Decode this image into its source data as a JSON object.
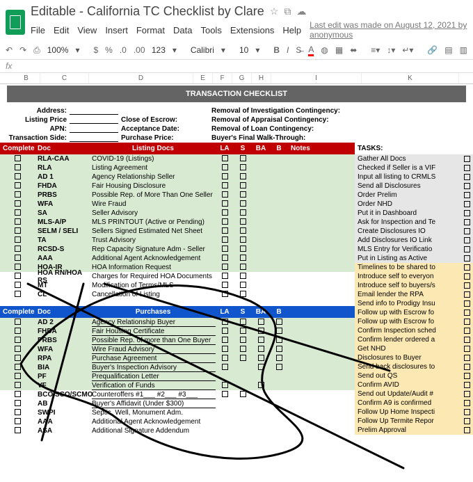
{
  "doc": {
    "title": "Editable - California TC Checklist by Clare"
  },
  "menu": [
    "File",
    "Edit",
    "View",
    "Insert",
    "Format",
    "Data",
    "Tools",
    "Extensions",
    "Help"
  ],
  "last_edit": "Last edit was made on August 12, 2021 by anonymous",
  "toolbar": {
    "zoom": "100%",
    "font": "Calibri",
    "size": "10",
    "fmt": "123"
  },
  "banner": "TRANSACTION CHECKLIST",
  "form": {
    "rows": [
      {
        "a": "Address:",
        "b": "",
        "c": "Removal of Investigation Contingency:"
      },
      {
        "a": "Listing Price",
        "b": "Close of Escrow:",
        "c": "Removal of Appraisal Contingency:"
      },
      {
        "a": "APN:",
        "b": "Acceptance Date:",
        "c": "Removal of Loan Contingency:"
      },
      {
        "a": "Transaction Side:",
        "b": "Purchase Price:",
        "c": "Buyer's Final Walk-Through:"
      }
    ]
  },
  "headers1": {
    "complete": "Complete",
    "doc": "Doc",
    "listing": "Listing Docs",
    "la": "LA",
    "s": "S",
    "ba": "BA",
    "b": "B",
    "notes": "Notes",
    "tasks": "TASKS:"
  },
  "headers2": {
    "complete": "Complete",
    "doc": "Doc",
    "listing": "Purchases",
    "la": "LA",
    "s": "S",
    "ba": "BA",
    "b": "B",
    "notes": ""
  },
  "tasks1": [
    "Gather All Docs",
    "Checked if Seller is a VIF",
    "Input all listing to CRMLS",
    "Send all Disclosures",
    "Order Prelim",
    "Order NHD",
    "Put it in Dashboard",
    "Ask for Inspection and Te",
    "Create Disclosures IO",
    "Add Disclosures IO Link",
    "MLS Entry for Verificatio",
    "Put in Listing as Active"
  ],
  "tasks2": [
    "Timelines to be shared to",
    "Introduce self to everyon",
    "Introduce self to buyers/s",
    "Email lender the RPA",
    "Send info to Prodigy Insu",
    "Follow up with Escrow fo",
    "Follow up with Escrow fo",
    "Confirm Inspection sched",
    "Confirm lender ordered a",
    "Get NHD",
    "Disclosures to Buyer",
    "Send back disclosures to",
    "Send out QS",
    "Confirm AVID",
    "Send out Update/Audit #",
    "Confirm A9 is confirmed",
    "Follow Up Home Inspecti",
    "Follow Up Termite Repor",
    "Prelim Approval"
  ],
  "listing_rows": [
    {
      "doc": "RLA-CAA",
      "name": "COVID-19 (Listings)"
    },
    {
      "doc": "RLA",
      "name": "Listing Agreement"
    },
    {
      "doc": "AD 1",
      "name": "Agency Relationship Seller"
    },
    {
      "doc": "FHDA",
      "name": "Fair Housing Disclosure"
    },
    {
      "doc": "PRBS",
      "name": "Possible Rep. of More Than One Seller"
    },
    {
      "doc": "WFA",
      "name": "Wire Fraud"
    },
    {
      "doc": "SA",
      "name": "Seller Advisory"
    },
    {
      "doc": "MLS-A/P",
      "name": "MLS PRINTOUT (Active or Pending)"
    },
    {
      "doc": "SELM / SELI",
      "name": "Sellers Signed Estimated Net Sheet"
    },
    {
      "doc": "TA",
      "name": "Trust Advisory"
    },
    {
      "doc": "RCSD-S",
      "name": "Rep Capacity Signature Adm - Seller"
    },
    {
      "doc": "AAA",
      "name": "Additional Agent Acknowledgement"
    },
    {
      "doc": "HOA-IR",
      "name": "HOA Information Request"
    },
    {
      "doc": "HOA RN/HOA RS",
      "name": "Charges for Required HOA Documents"
    },
    {
      "doc": "MT",
      "name": "Modification of Terms/MLS"
    },
    {
      "doc": "CL",
      "name": "Cancellation of Listing"
    }
  ],
  "purchase_rows": [
    {
      "doc": "AD 2",
      "name": "Agency Relationship Buyer",
      "ul": true,
      "la": true,
      "s": true,
      "ba": true,
      "b": true
    },
    {
      "doc": "FHDA",
      "name": "Fair Housing Certificate",
      "ul": true,
      "la": true,
      "s": true,
      "ba": true,
      "b": true
    },
    {
      "doc": "PRBS",
      "name": "Possible Rep. of more than One Buyer",
      "ul": true,
      "la": true,
      "s": true,
      "ba": true,
      "b": true
    },
    {
      "doc": "WFA",
      "name": "Wire Fraud Advisory",
      "ul": true,
      "la": true,
      "s": true,
      "ba": true,
      "b": true
    },
    {
      "doc": "RPA",
      "name": "Purchase Agreement",
      "ul": true,
      "la": true,
      "s": true,
      "ba": true,
      "b": true
    },
    {
      "doc": "BIA",
      "name": "Buyer's Inspection Advisory",
      "ul": true,
      "la": true,
      "s": false,
      "ba": true,
      "b": true
    },
    {
      "doc": "PF",
      "name": "Prequalification Letter",
      "ul": true,
      "la": false,
      "s": false,
      "ba": false,
      "b": false
    },
    {
      "doc": "VF",
      "name": "Verification of Funds",
      "ul": true,
      "la": true,
      "s": false,
      "ba": true,
      "b": false
    },
    {
      "doc": "BCO/SCO/SCMO",
      "name": "Counteroffers #1___ #2___ #3___",
      "ul": true,
      "la": true,
      "s": true,
      "ba": false,
      "b": false,
      "white": true
    },
    {
      "doc": "AB",
      "name": "Buyer's Affidavit (Under $300)",
      "ul": true,
      "la": false,
      "s": false,
      "ba": false,
      "b": false,
      "white": true
    },
    {
      "doc": "SWPI",
      "name": "Septic, Well, Monument Adm.",
      "ul": false,
      "la": false,
      "s": false,
      "ba": false,
      "b": false,
      "white": true
    },
    {
      "doc": "AAA",
      "name": "Additional Agent Acknowledgement",
      "ul": false,
      "la": false,
      "s": false,
      "ba": false,
      "b": false,
      "white": true
    },
    {
      "doc": "ASA",
      "name": "Additional Signature Addendum",
      "ul": false,
      "la": false,
      "s": false,
      "ba": false,
      "b": false,
      "white": true
    }
  ],
  "col_letters": [
    "B",
    "C",
    "D",
    "E",
    "F",
    "G",
    "H",
    "I",
    "K"
  ]
}
